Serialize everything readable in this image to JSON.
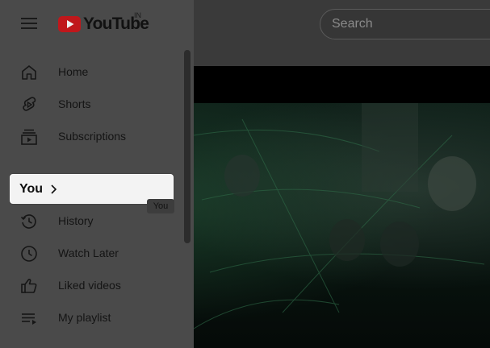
{
  "header": {
    "logo_text": "YouTube",
    "country_code": "IN",
    "search_placeholder": "Search"
  },
  "sidebar": {
    "items": [
      {
        "label": "Home",
        "icon": "home-icon"
      },
      {
        "label": "Shorts",
        "icon": "shorts-icon"
      },
      {
        "label": "Subscriptions",
        "icon": "subscriptions-icon"
      },
      {
        "label": "You",
        "icon": "chevron-right-icon",
        "highlighted": true
      },
      {
        "label": "History",
        "icon": "history-icon"
      },
      {
        "label": "Watch Later",
        "icon": "clock-icon"
      },
      {
        "label": "Liked videos",
        "icon": "thumbs-up-icon"
      },
      {
        "label": "My playlist",
        "icon": "playlist-icon"
      }
    ],
    "tooltip": "You"
  },
  "colors": {
    "sidebar_bg": "#4a4a4a",
    "highlight_bg": "#f3f3f3",
    "logo_red": "#ff0000",
    "overlay_topbar": "#3a3a3a"
  }
}
